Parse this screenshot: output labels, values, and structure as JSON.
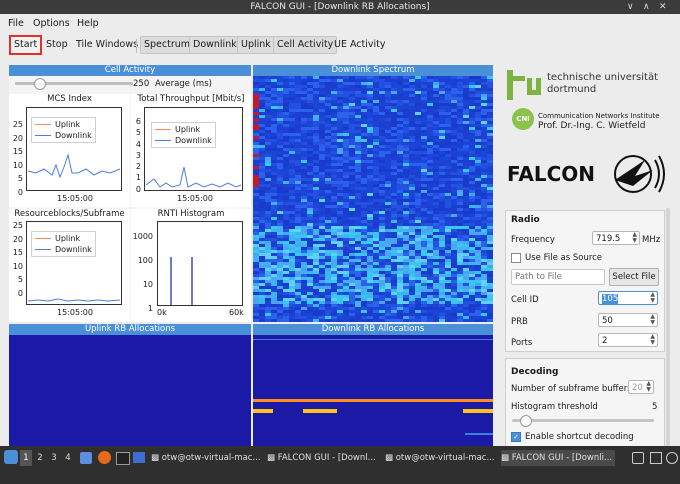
{
  "window": {
    "title": "FALCON GUI - [Downlink RB Allocations]"
  },
  "menu": {
    "file": "File",
    "options": "Options",
    "help": "Help"
  },
  "toolbar": {
    "start": "Start",
    "stop": "Stop",
    "tile": "Tile Windows",
    "spectrum": "Spectrum",
    "downlink": "Downlink",
    "uplink": "Uplink",
    "cell_activity": "Cell Activity",
    "ue_activity": "UE Activity"
  },
  "cell_activity": {
    "title": "Cell Activity",
    "average_value": "250",
    "average_label": "Average (ms)",
    "slider_fraction": 0.17,
    "mcs": {
      "title": "MCS Index",
      "yticks": [
        "25",
        "20",
        "15",
        "10",
        "5",
        "0"
      ],
      "xtick": "15:05:00",
      "legend": [
        "Uplink",
        "Downlink"
      ]
    },
    "throughput": {
      "title": "Total Throughput [Mbit/s]",
      "yticks": [
        "6",
        "5",
        "4",
        "3",
        "2",
        "1",
        "0"
      ],
      "xtick": "15:05:00",
      "legend": [
        "Uplink",
        "Downlink"
      ]
    },
    "resourceblocks": {
      "title": "Resourceblocks/Subframe",
      "yticks": [
        "25",
        "20",
        "15",
        "10",
        "5",
        "0"
      ],
      "xtick": "15:05:00",
      "legend": [
        "Uplink",
        "Downlink"
      ]
    },
    "rnti": {
      "title": "RNTI Histogram",
      "yticks": [
        "1000",
        "100",
        "10",
        "1"
      ],
      "xticks": [
        "0k",
        "60k"
      ]
    }
  },
  "colors": {
    "uplink": "#f08a5d",
    "downlink": "#4a7fe0",
    "header": "#4a90d9",
    "red_outline": "#e03030"
  },
  "downlink_spectrum": {
    "title": "Downlink Spectrum"
  },
  "uplink_rb": {
    "title": "Uplink RB Allocations"
  },
  "downlink_rb": {
    "title": "Downlink RB Allocations"
  },
  "logos": {
    "tu_line1": "technische universität",
    "tu_line2": "dortmund",
    "cni_badge": "CNI",
    "cni_line1": "Communication Networks Institute",
    "cni_line2": "Prof. Dr.-Ing. C. Wietfeld",
    "falcon": "FALCON"
  },
  "radio": {
    "title": "Radio",
    "frequency_label": "Frequency",
    "frequency_value": "719.5",
    "frequency_unit": "MHz",
    "use_file_label": "Use File as Source",
    "path_placeholder": "Path to File",
    "select_file": "Select File",
    "cell_id_label": "Cell ID",
    "cell_id_value": "105",
    "prb_label": "PRB",
    "prb_value": "50",
    "ports_label": "Ports",
    "ports_value": "2"
  },
  "decoding": {
    "title": "Decoding",
    "buffers_label": "Number of subframe buffers",
    "buffers_value": "20",
    "hist_label": "Histogram threshold",
    "hist_value": "5",
    "hist_fraction": 0.06,
    "shortcut_label": "Enable shortcut decoding"
  },
  "taskbar": {
    "workspaces": [
      "1",
      "2",
      "3",
      "4"
    ],
    "tasks": [
      "otw@otw-virtual-mac...",
      "FALCON GUI - [Downl...",
      "otw@otw-virtual-mac...",
      "FALCON GUI - [Downli..."
    ]
  }
}
